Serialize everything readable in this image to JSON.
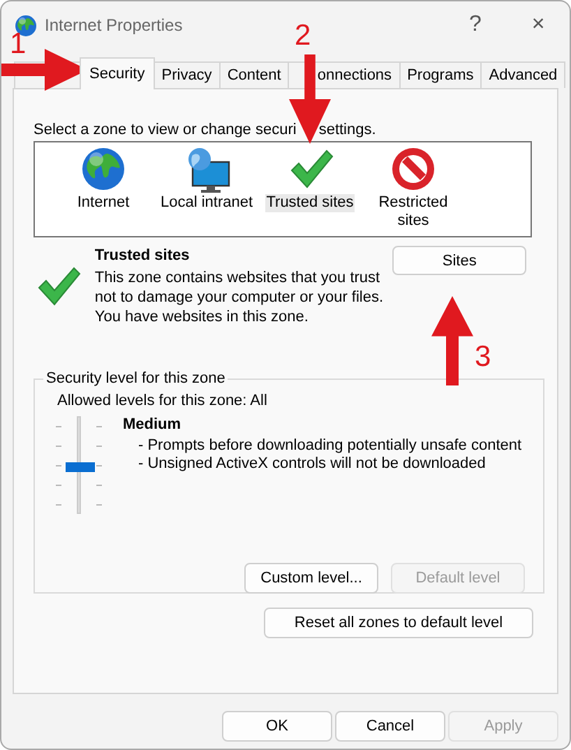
{
  "window": {
    "title": "Internet Properties",
    "help": "?",
    "close": "×"
  },
  "tabs": [
    {
      "label": "Security",
      "selected": true
    },
    {
      "label": "Privacy",
      "selected": false
    },
    {
      "label": "Content",
      "selected": false
    },
    {
      "label": "onnections",
      "selected": false
    },
    {
      "label": "Programs",
      "selected": false
    },
    {
      "label": "Advanced",
      "selected": false
    }
  ],
  "instruction": [
    "Select a zone to view or change securi",
    "settings."
  ],
  "zones": [
    {
      "label": "Internet",
      "kind": "globe",
      "selected": false
    },
    {
      "label": "Local intranet",
      "kind": "network",
      "selected": false
    },
    {
      "label": "Trusted sites",
      "kind": "check",
      "selected": true
    },
    {
      "label": "Restricted sites",
      "kind": "blocked",
      "selected": false
    }
  ],
  "zone_info": {
    "title": "Trusted sites",
    "description": [
      "This zone contains websites that you trust not to damage your computer or your files.",
      "You have websites in this zone."
    ],
    "sites_button": "Sites"
  },
  "security_level": {
    "legend": "Security level for this zone",
    "allowed": "Allowed levels for this zone: All",
    "level": 0.5,
    "name": "Medium",
    "details": [
      "- Prompts before downloading potentially unsafe content",
      "- Unsigned ActiveX controls will not be downloaded"
    ],
    "buttons": [
      {
        "label": "Custom level...",
        "disabled": false
      },
      {
        "label": "Default level",
        "disabled": true
      }
    ]
  },
  "reset_button": "Reset all zones to default level",
  "footer_buttons": [
    {
      "label": "OK",
      "disabled": false
    },
    {
      "label": "Cancel",
      "disabled": false
    },
    {
      "label": "Apply",
      "disabled": true
    }
  ],
  "annotations": [
    {
      "label": "1",
      "kind": "right"
    },
    {
      "label": "2",
      "kind": "down"
    },
    {
      "label": "3",
      "kind": "up"
    }
  ]
}
